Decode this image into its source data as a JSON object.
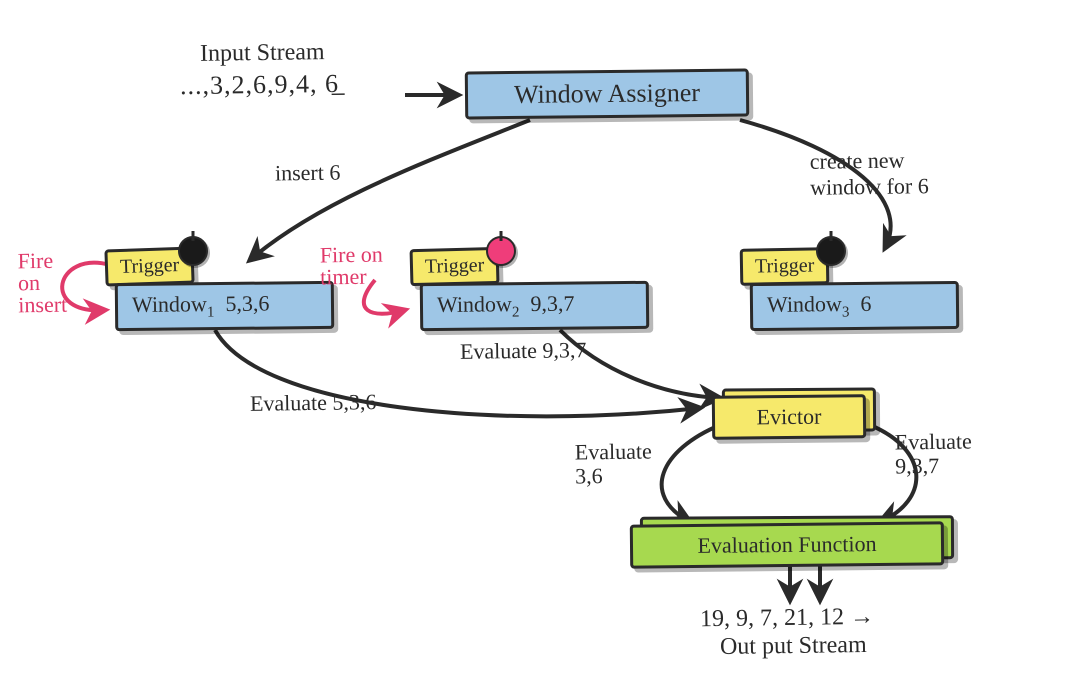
{
  "input": {
    "title": "Input Stream",
    "values": "...,3,2,6,9,4, 6̲"
  },
  "assigner": {
    "label": "Window Assigner"
  },
  "edges": {
    "insert": "insert 6",
    "createNew": "create new\nwindow for 6",
    "evaluate536": "Evaluate  5,3,6",
    "evaluate937": "Evaluate 9,3,7",
    "evaluate36": "Evaluate\n3,6",
    "evaluate937b": "Evaluate\n9,3,7"
  },
  "triggers": {
    "fireOnInsert": "Fire\non\ninsert",
    "fireOnTimer": "Fire on\ntimer",
    "label": "Trigger"
  },
  "windows": {
    "w1": {
      "name": "Window",
      "sub": "1",
      "values": "5,3,6"
    },
    "w2": {
      "name": "Window",
      "sub": "2",
      "values": "9,3,7"
    },
    "w3": {
      "name": "Window",
      "sub": "3",
      "values": "6"
    }
  },
  "evictor": {
    "label": "Evictor"
  },
  "evalFn": {
    "label": "Evaluation Function"
  },
  "output": {
    "values": "19, 9, 7, 21, 12 →",
    "title": "Out put  Stream"
  }
}
